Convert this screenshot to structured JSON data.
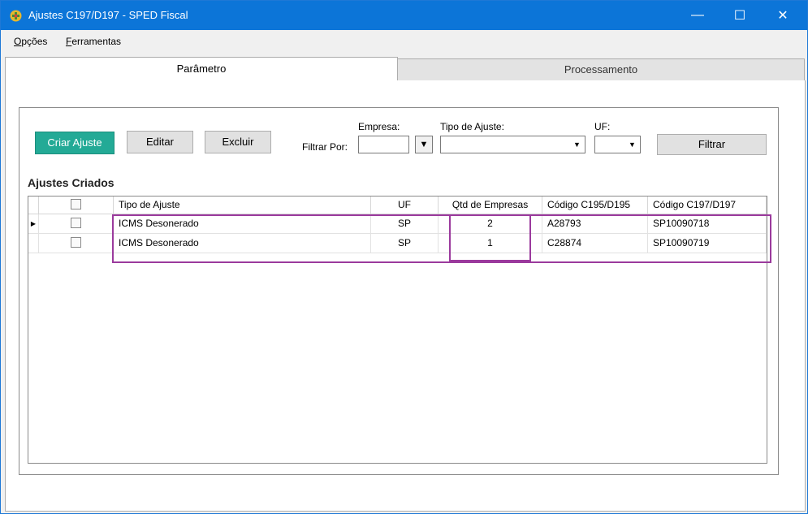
{
  "window": {
    "title": "Ajustes C197/D197 - SPED Fiscal",
    "minimize": "—",
    "maximize": "☐",
    "close": "✕"
  },
  "menu": [
    {
      "mnemonic": "O",
      "rest": "pções"
    },
    {
      "mnemonic": "F",
      "rest": "erramentas"
    }
  ],
  "tabs": [
    {
      "label": "Parâmetro",
      "active": true
    },
    {
      "label": "Processamento",
      "active": false
    }
  ],
  "toolbar": {
    "create_label": "Criar Ajuste",
    "edit_label": "Editar",
    "delete_label": "Excluir",
    "filter_by_label": "Filtrar Por:",
    "empresa_label": "Empresa:",
    "empresa_value": "",
    "empresa_dropdown_glyph": "▼",
    "tipo_label": "Tipo de Ajuste:",
    "tipo_value": "",
    "uf_label": "UF:",
    "uf_value": "",
    "filter_button": "Filtrar"
  },
  "section_title": "Ajustes Criados",
  "grid": {
    "columns": [
      "",
      "Tipo de Ajuste",
      "UF",
      "Qtd de Empresas",
      "Código C195/D195",
      "Código C197/D197"
    ],
    "rows": [
      {
        "checked": false,
        "current": true,
        "tipo": "ICMS Desonerado",
        "uf": "SP",
        "qtd": "2",
        "c195": "A28793",
        "c197": "SP10090718"
      },
      {
        "checked": false,
        "current": false,
        "tipo": "ICMS Desonerado",
        "uf": "SP",
        "qtd": "1",
        "c195": "C28874",
        "c197": "SP10090719"
      }
    ]
  },
  "colors": {
    "titlebar": "#0c75d8",
    "primary_button": "#23aa96",
    "highlight": "#9b3a9d"
  }
}
